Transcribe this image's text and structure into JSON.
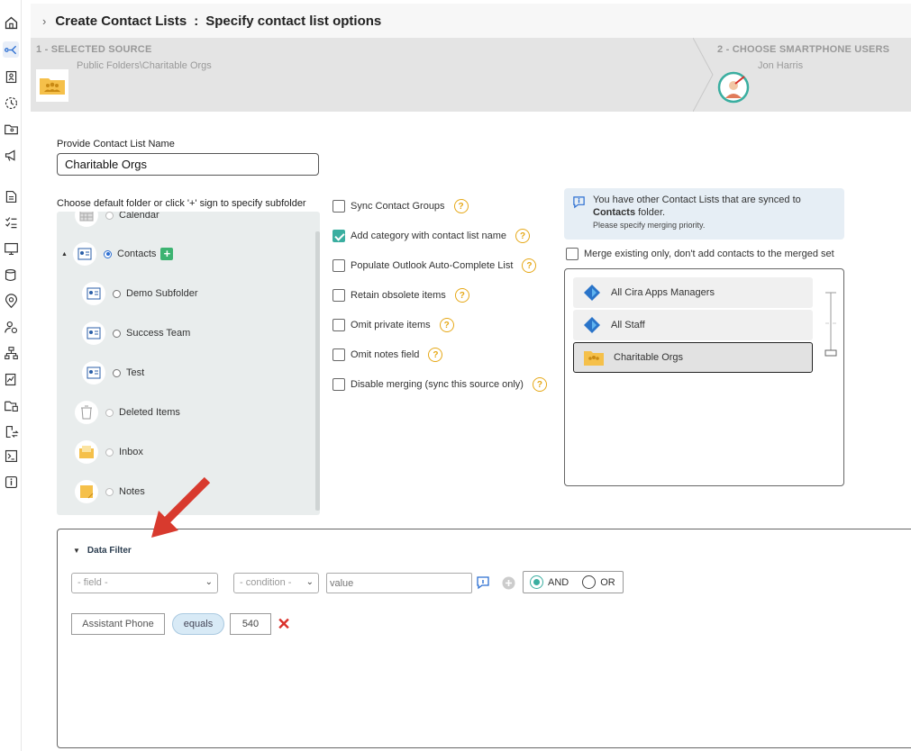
{
  "header": {
    "title": "Create Contact Lists",
    "separator": ":",
    "subtitle": "Specify contact list options"
  },
  "wizard": {
    "step1_title": "1 - SELECTED SOURCE",
    "step1_value": "Public Folders\\Charitable Orgs",
    "step2_title": "2 - CHOOSE SMARTPHONE USERS",
    "step2_value": "Jon Harris"
  },
  "form": {
    "name_label": "Provide Contact List Name",
    "name_value": "Charitable Orgs",
    "folder_label": "Choose default folder or click '+' sign to specify subfolder"
  },
  "tree": [
    {
      "label": "Calendar",
      "icon": "calendar-icon",
      "selected": false
    },
    {
      "label": "Contacts",
      "icon": "contact-card-icon",
      "selected": true
    },
    {
      "label": "Demo Subfolder",
      "icon": "contact-card-icon",
      "selected": false
    },
    {
      "label": "Success Team",
      "icon": "contact-card-icon",
      "selected": false
    },
    {
      "label": "Test",
      "icon": "contact-card-icon",
      "selected": false
    },
    {
      "label": "Deleted Items",
      "icon": "trash-icon",
      "selected": false
    },
    {
      "label": "Inbox",
      "icon": "inbox-icon",
      "selected": false
    },
    {
      "label": "Notes",
      "icon": "note-icon",
      "selected": false
    }
  ],
  "options": [
    {
      "label": "Sync Contact Groups",
      "checked": false
    },
    {
      "label": "Add category with contact list name",
      "checked": true
    },
    {
      "label": "Populate Outlook Auto-Complete List",
      "checked": false
    },
    {
      "label": "Retain obsolete items",
      "checked": false
    },
    {
      "label": "Omit private items",
      "checked": false
    },
    {
      "label": "Omit notes field",
      "checked": false
    },
    {
      "label": "Disable merging (sync this source only)",
      "checked": false
    }
  ],
  "help_glyph": "?",
  "info": {
    "line1": "You have other Contact Lists that are synced to",
    "bold": "Contacts",
    "line1b": " folder.",
    "line2": "Please specify merging priority."
  },
  "merge": {
    "label": "Merge existing only, don't add contacts to the merged set",
    "checked": false
  },
  "merge_list": [
    {
      "label": "All Cira Apps Managers",
      "icon": "azure-icon"
    },
    {
      "label": "All Staff",
      "icon": "azure-icon"
    },
    {
      "label": "Charitable Orgs",
      "icon": "folder-people-icon",
      "selected": true
    }
  ],
  "filter": {
    "title": "Data Filter",
    "field_placeholder": "- field -",
    "condition_placeholder": "- condition -",
    "value_placeholder": "value",
    "and_label": "AND",
    "or_label": "OR",
    "rule": {
      "field": "Assistant Phone",
      "condition": "equals",
      "value": "540",
      "remove": "✕"
    }
  },
  "colors": {
    "accent": "#3aaea0",
    "link": "#2b6ed1",
    "help": "#e6a817",
    "remove": "#d9312b",
    "wizard_bg": "#e4e4e4",
    "tree_bg": "#e9eded",
    "arrow": "#d83a2e"
  }
}
